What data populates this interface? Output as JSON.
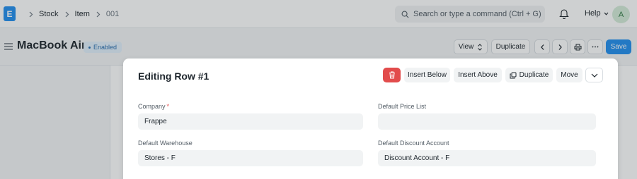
{
  "navbar": {
    "logo_letter": "E",
    "breadcrumbs": [
      "Stock",
      "Item",
      "001"
    ],
    "search_placeholder": "Search or type a command (Ctrl + G)",
    "help_label": "Help",
    "avatar_initial": "A"
  },
  "page": {
    "title": "MacBook Air",
    "status": "Enabled",
    "buttons": {
      "view": "View",
      "duplicate": "Duplicate",
      "save": "Save"
    }
  },
  "modal": {
    "title": "Editing Row #1",
    "buttons": {
      "insert_below": "Insert Below",
      "insert_above": "Insert Above",
      "duplicate": "Duplicate",
      "move": "Move"
    },
    "fields": {
      "company": {
        "label": "Company",
        "required_mark": "*",
        "value": "Frappe"
      },
      "default_price_list": {
        "label": "Default Price List",
        "value": ""
      },
      "default_warehouse": {
        "label": "Default Warehouse",
        "value": "Stores - F"
      },
      "default_discount_account": {
        "label": "Default Discount Account",
        "value": "Discount Account - F"
      }
    }
  },
  "colors": {
    "accent": "#2490ef",
    "danger": "#e24c4c",
    "status_bg": "#e2f0fb"
  },
  "icons": [
    "app-logo",
    "chevron-right-icon",
    "search-icon",
    "bell-icon",
    "chevron-down-icon",
    "hamburger-icon",
    "sort-icon",
    "chevron-left-icon",
    "printer-icon",
    "more-icon",
    "trash-icon",
    "duplicate-icon"
  ]
}
